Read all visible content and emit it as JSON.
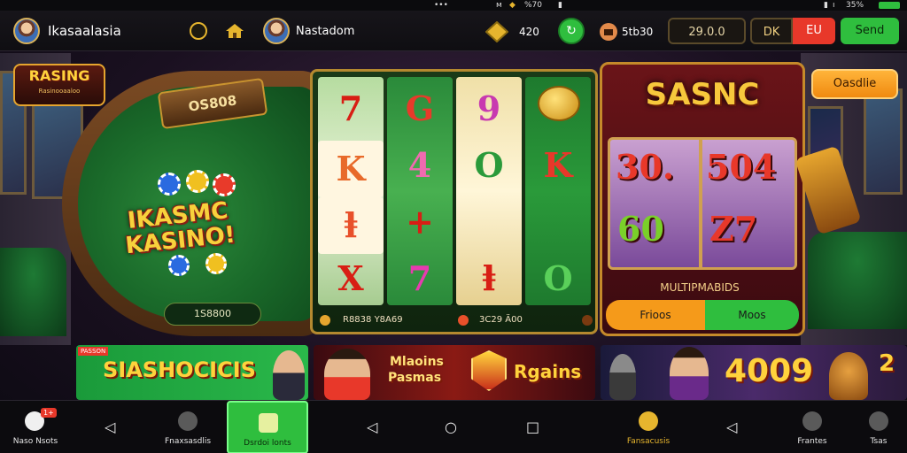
{
  "status_bar": {
    "left": "",
    "center": "•••",
    "right_items": [
      "ᴍ",
      "◆",
      "%70",
      "▮",
      "▮",
      "ı",
      "35%"
    ]
  },
  "top_bar": {
    "app_name": "Ikasaalasia",
    "player_name": "Nastadom",
    "coin_count": "420",
    "balance_label": "5tb30",
    "balance_value": "29.0.0",
    "toggle_left": "DK",
    "toggle_right": "EU",
    "action_label": "Send"
  },
  "brand": {
    "title": "RASING",
    "subtitle": "Rasinooaaloo"
  },
  "table": {
    "sign_text": "OS808",
    "logo_line1": "IKASMC",
    "logo_line2": "KASINO!",
    "counter": "1S8800"
  },
  "reels": {
    "columns": [
      [
        "7",
        "K",
        "ⱡ",
        "X"
      ],
      [
        "G",
        "4",
        "+",
        "7"
      ],
      [
        "9",
        "O",
        "",
        "ⱡ"
      ],
      [
        "●",
        "K",
        "",
        "O"
      ]
    ],
    "footer_left": "R8838 Y8A69",
    "footer_right": "3C29 Ä00"
  },
  "right_panel": {
    "title": "SASNC",
    "numbers": [
      "30.",
      "504",
      "60",
      "Z7"
    ],
    "multiplier_label": "MULTIPMABIDS",
    "button_left": "Frioos",
    "button_right": "Moos"
  },
  "orange_button": "Oasdlie",
  "banners": [
    {
      "text": "SIASHOCICIS",
      "tag": "PASSON"
    },
    {
      "text1": "Mlaoins",
      "text2": "Pasmas",
      "text3": "Rgains"
    },
    {
      "text": "4009",
      "suffix": "2"
    }
  ],
  "bottom_nav": {
    "items": [
      "Naso Nsots",
      "Fnaxsasdlis",
      "Dsrdoi lonts",
      "Fansacusis",
      "Frantes",
      "Tsas"
    ],
    "badge": "1+"
  },
  "colors": {
    "green": "#2fbe3e",
    "gold": "#e6b52e",
    "red": "#e8382a",
    "orange": "#f59a1a",
    "felt": "#1a6a2a"
  }
}
